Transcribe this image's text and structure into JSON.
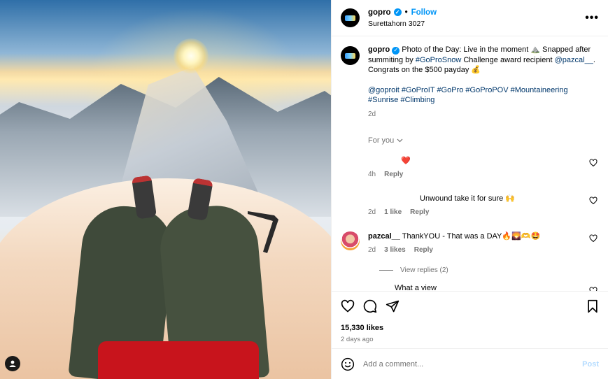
{
  "header": {
    "username": "gopro",
    "follow_label": "Follow",
    "location": "Surettahorn 3027",
    "separator": "•"
  },
  "caption": {
    "username": "gopro",
    "text_a": "Photo of the Day: Live in the moment ⛰️ Snapped after summiting by ",
    "link1": "#GoProSnow",
    "text_b": " Challenge award recipient ",
    "link2": "@pazcal__",
    "text_c": ". Congrats on the $500 payday 💰",
    "tags": [
      "@goproit",
      "#GoProIT",
      "#GoPro",
      "#GoProPOV",
      "#Mountaineering",
      "#Sunrise",
      "#Climbing"
    ],
    "time": "2d"
  },
  "for_you_label": "For you",
  "comments": [
    {
      "username": "",
      "text": "❤️",
      "time": "4h",
      "likes": "",
      "reply": "Reply"
    },
    {
      "username": "",
      "text": "Unwound take it for sure 🙌",
      "time": "2d",
      "likes": "1 like",
      "reply": "Reply"
    },
    {
      "username": "pazcal__",
      "text": "ThankYOU - That was a DAY🔥🌄🫶🤩",
      "time": "2d",
      "likes": "3 likes",
      "reply": "Reply"
    },
    {
      "username": "",
      "text": "What a view",
      "time": "",
      "likes": "",
      "reply": ""
    }
  ],
  "view_replies": "View replies (2)",
  "likes_count": "15,330 likes",
  "posted_ago": "2 days ago",
  "add_comment": {
    "placeholder": "Add a comment...",
    "post_label": "Post"
  },
  "colors": {
    "accent": "#0095f6",
    "link": "#00376b",
    "muted": "#737373"
  }
}
